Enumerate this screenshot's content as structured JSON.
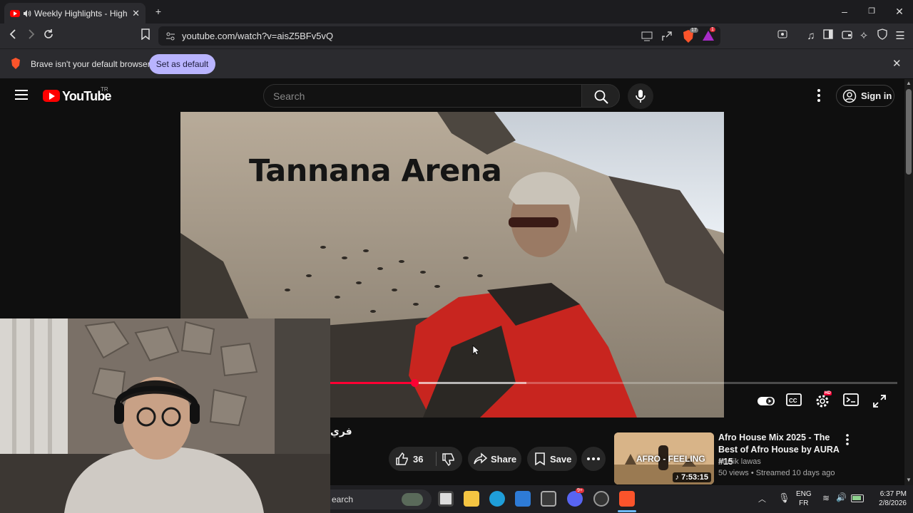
{
  "browser": {
    "tab_title": "Weekly Highlights - Highlight",
    "url": "youtube.com/watch?v=aisZ5BFv5vQ",
    "shield_count": "17",
    "rewards_badge": "1"
  },
  "banner": {
    "message": "Brave isn't your default browser",
    "set_default_label": "Set as default"
  },
  "youtube": {
    "logo_text": "YouTube",
    "country": "TR",
    "search_placeholder": "Search",
    "signin_label": "Sign in"
  },
  "video": {
    "overlay_title": "Tannana Arena",
    "progress_played_fraction": 0.149,
    "progress_loaded_fraction": 0.346,
    "hd_badge": "HD"
  },
  "below_video": {
    "title_fragment": "فري",
    "like_count": "36",
    "share_label": "Share",
    "save_label": "Save"
  },
  "recommendation": {
    "title": "Afro House Mix 2025 - The Best of Afro House by AURA #15",
    "channel": "Musik lawas",
    "views": "50 views",
    "streamed": "Streamed 10 days ago",
    "meta": "50 views • Streamed 10 days ago",
    "duration": "7:53:15",
    "thumb_text": "AFRO - FEELING"
  },
  "taskbar": {
    "search_text": "earch",
    "lang_primary": "ENG",
    "lang_secondary": "FR",
    "time": "6:37 PM",
    "date": "2/8/2026",
    "discord_badge": "9+"
  },
  "colors": {
    "accent_red": "#ff0033",
    "brave_orange": "#fb542b",
    "set_default_bg": "#b9b4ff"
  }
}
